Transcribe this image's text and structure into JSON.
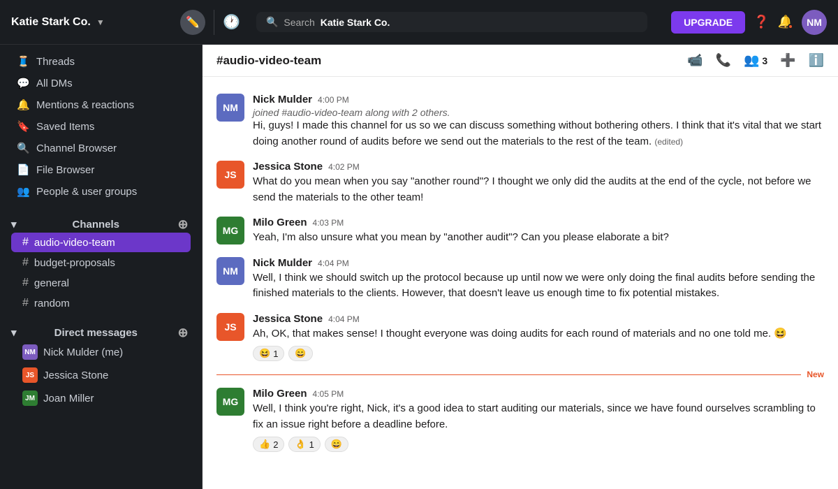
{
  "topbar": {
    "workspace": "Katie Stark Co.",
    "search_prefix": "Search",
    "search_workspace": "Katie Stark Co.",
    "upgrade_label": "UPGRADE"
  },
  "sidebar": {
    "nav_items": [
      {
        "id": "threads",
        "label": "Threads",
        "icon": "🧵"
      },
      {
        "id": "all-dms",
        "label": "All DMs",
        "icon": "💬"
      },
      {
        "id": "mentions",
        "label": "Mentions & reactions",
        "icon": "🔔"
      },
      {
        "id": "saved",
        "label": "Saved Items",
        "icon": "🔖"
      },
      {
        "id": "channel-browser",
        "label": "Channel Browser",
        "icon": "🔍"
      },
      {
        "id": "file-browser",
        "label": "File Browser",
        "icon": "📄"
      },
      {
        "id": "people",
        "label": "People & user groups",
        "icon": "👥"
      }
    ],
    "channels_section": "Channels",
    "channels": [
      {
        "id": "audio-video-team",
        "label": "audio-video-team",
        "active": true
      },
      {
        "id": "budget-proposals",
        "label": "budget-proposals",
        "active": false
      },
      {
        "id": "general",
        "label": "general",
        "active": false
      },
      {
        "id": "random",
        "label": "random",
        "active": false
      }
    ],
    "dm_section": "Direct messages",
    "dms": [
      {
        "id": "nick-mulder",
        "label": "Nick Mulder (me)",
        "color": "#7c5cbf",
        "initials": "NM"
      },
      {
        "id": "jessica-stone",
        "label": "Jessica Stone",
        "color": "#e8562a",
        "initials": "JS"
      },
      {
        "id": "joan-miller",
        "label": "Joan Miller",
        "color": "#2e7d32",
        "initials": "JM"
      }
    ]
  },
  "chat": {
    "channel_name": "#audio-video-team",
    "member_count": "3",
    "messages": [
      {
        "id": "msg1",
        "author": "Nick Mulder",
        "time": "4:00 PM",
        "avatar_color": "#5c6bc0",
        "initials": "NM",
        "join_text": "joined #audio-video-team along with 2 others.",
        "text": "Hi, guys! I made this channel for us so we can discuss something without bothering others. I think that it's vital that we start doing another round of audits before we send out the materials to the rest of the team.",
        "edited": "(edited)",
        "reactions": []
      },
      {
        "id": "msg2",
        "author": "Jessica Stone",
        "time": "4:02 PM",
        "avatar_color": "#e8562a",
        "initials": "JS",
        "text": "What do you mean when you say \"another round\"? I thought we only did the audits at the end of the cycle, not before we send the materials to the other team!",
        "reactions": []
      },
      {
        "id": "msg3",
        "author": "Milo Green",
        "time": "4:03 PM",
        "avatar_color": "#2e7d32",
        "initials": "MG",
        "text": "Yeah, I'm also unsure what you mean by \"another audit\"? Can you please elaborate a bit?",
        "reactions": []
      },
      {
        "id": "msg4",
        "author": "Nick Mulder",
        "time": "4:04 PM",
        "avatar_color": "#5c6bc0",
        "initials": "NM",
        "text": "Well, I think we should switch up the protocol because up until now we were only doing the final audits before sending the finished materials to the clients. However, that doesn't leave us enough time to fix potential mistakes.",
        "reactions": []
      },
      {
        "id": "msg5",
        "author": "Jessica Stone",
        "time": "4:04 PM",
        "avatar_color": "#e8562a",
        "initials": "JS",
        "text": "Ah, OK, that makes sense! I thought everyone was doing audits for each round of materials and no one told me. 😆",
        "reactions": [
          {
            "emoji": "😆",
            "count": "1"
          },
          {
            "emoji": "😄",
            "count": ""
          }
        ]
      },
      {
        "id": "msg6",
        "author": "Milo Green",
        "time": "4:05 PM",
        "avatar_color": "#2e7d32",
        "initials": "MG",
        "text": "Well, I think you're right, Nick, it's a good idea to start auditing our materials, since we have found ourselves scrambling to fix an issue right before a deadline before.",
        "is_new": true,
        "reactions": [
          {
            "emoji": "👍",
            "count": "2"
          },
          {
            "emoji": "👌",
            "count": "1"
          },
          {
            "emoji": "😄",
            "count": ""
          }
        ]
      }
    ]
  }
}
